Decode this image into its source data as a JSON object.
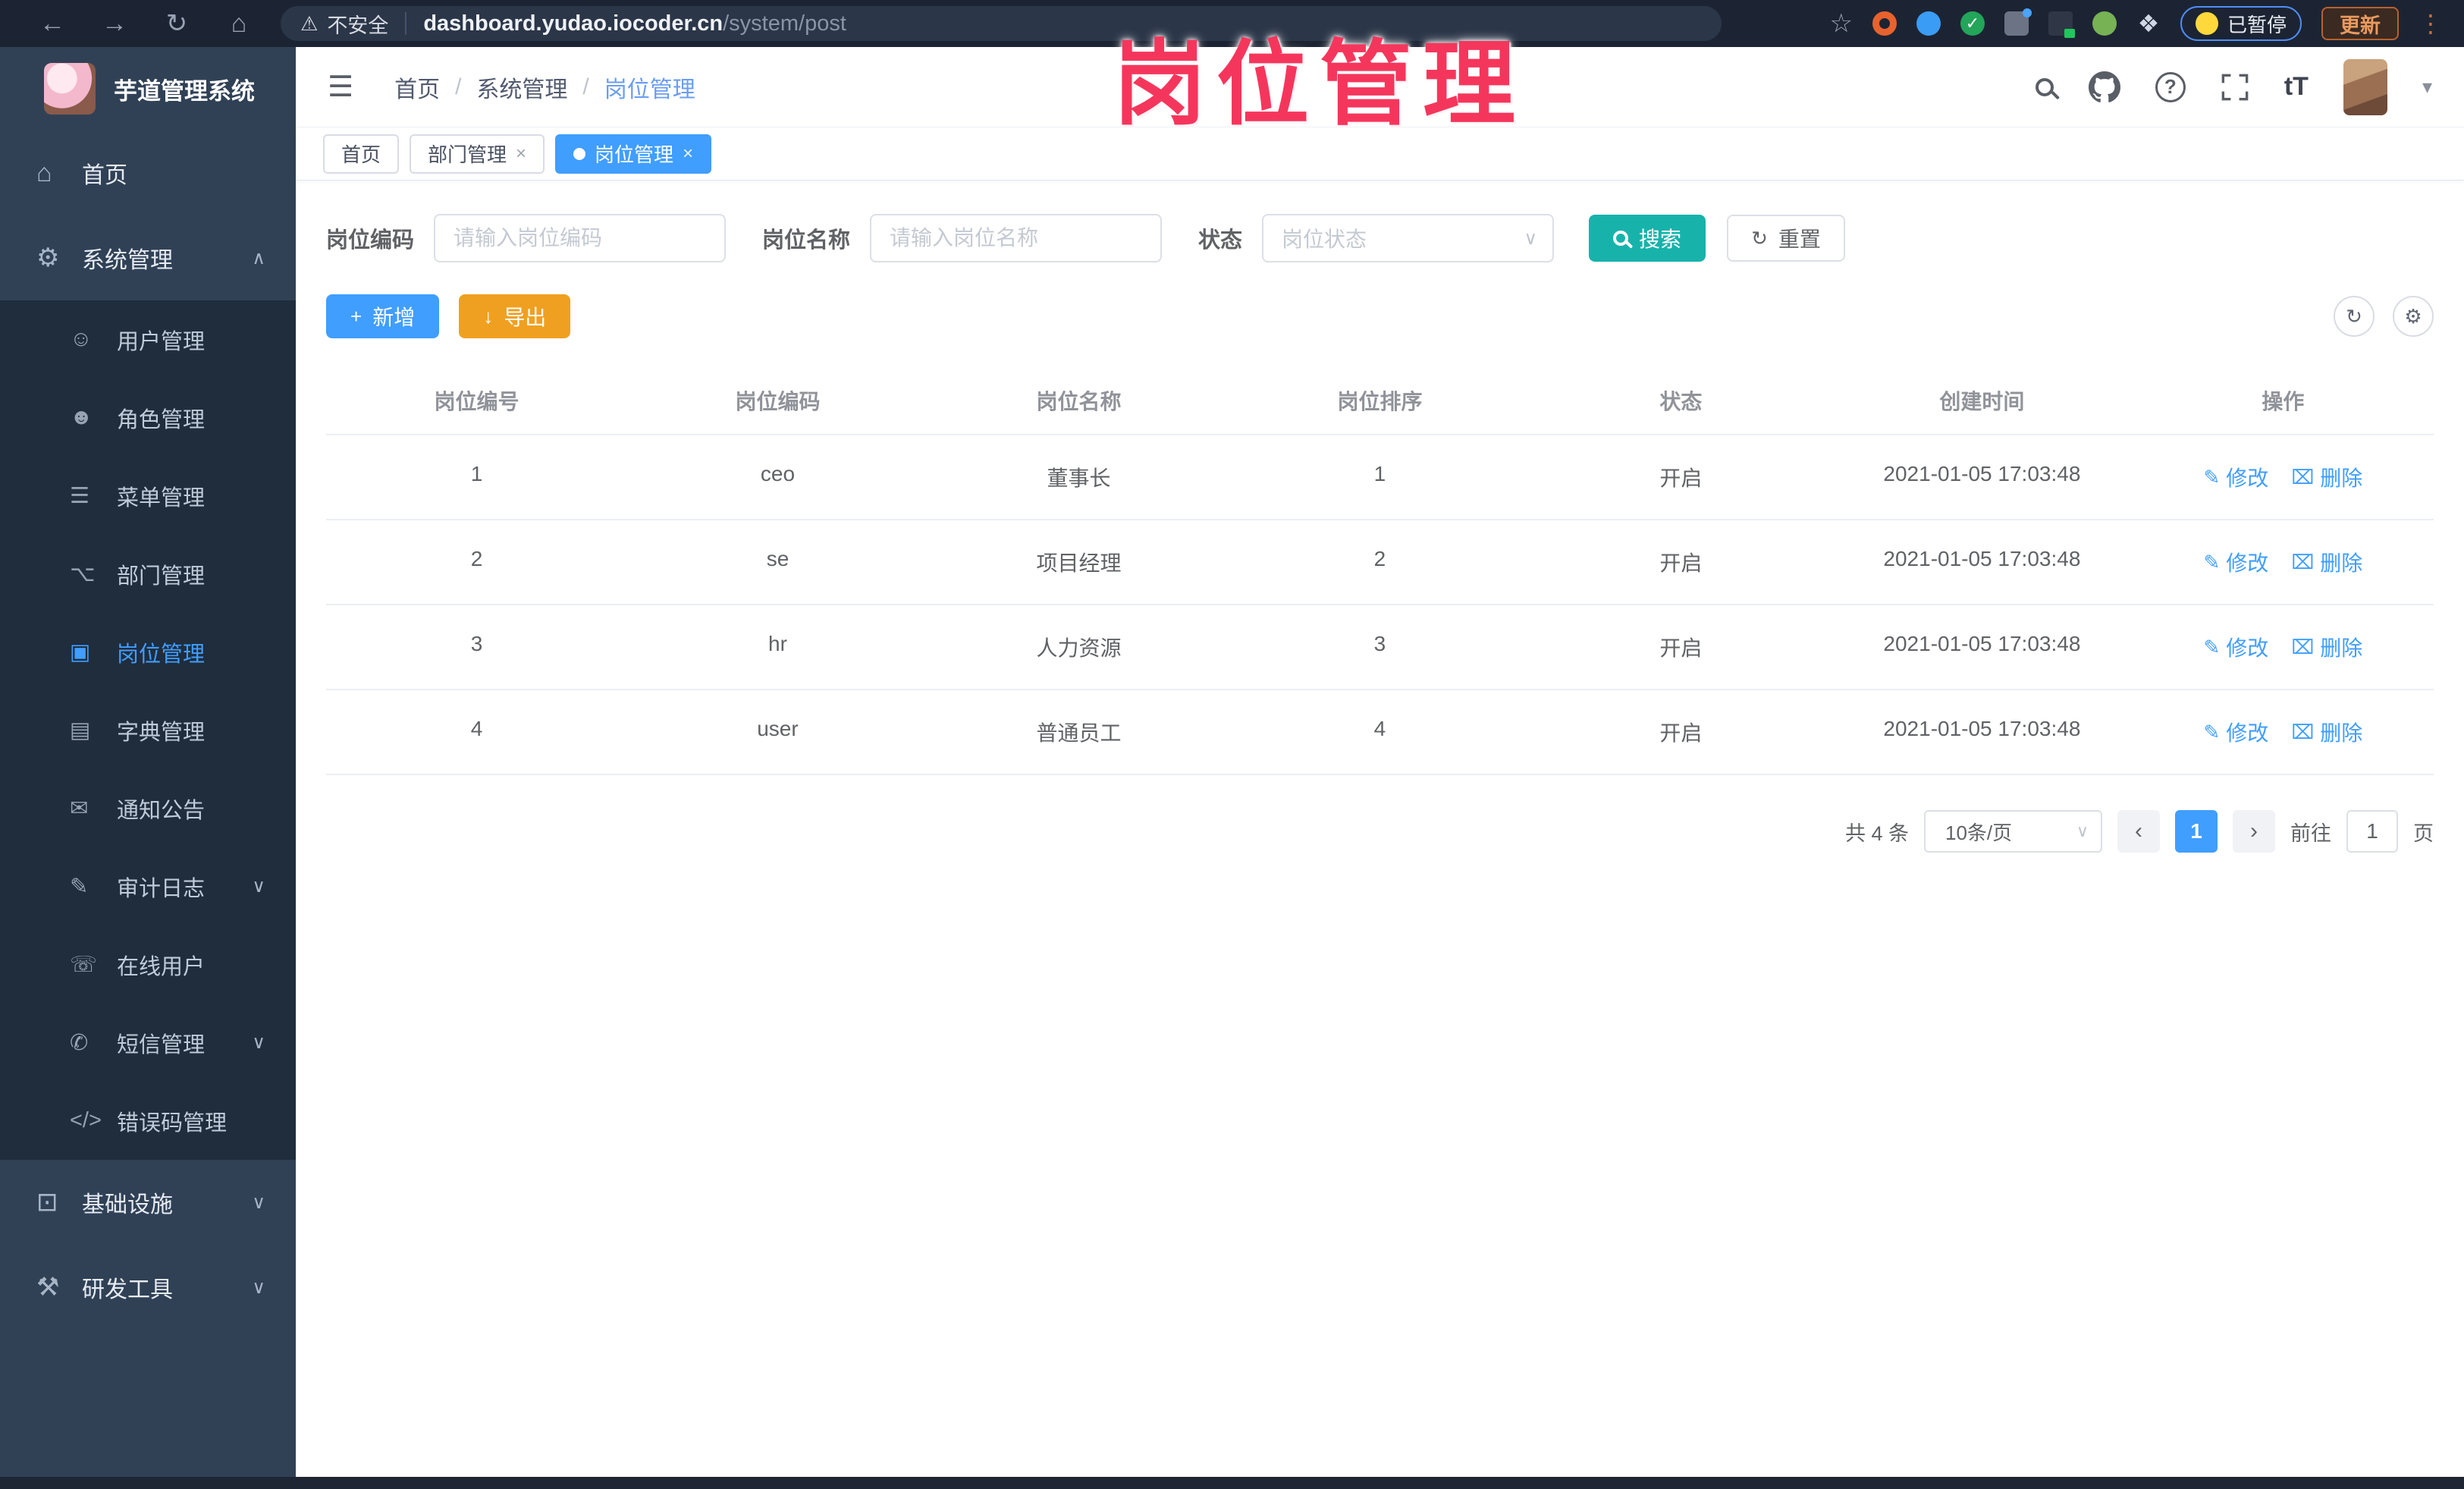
{
  "browser": {
    "security_label": "不安全",
    "url_host": "dashboard.yudao.iocoder.cn",
    "url_path": "/system/post",
    "paused_label": "已暂停",
    "update_label": "更新"
  },
  "watermark": "岗位管理",
  "icons": {
    "back": "←",
    "forward": "→",
    "reload": "↻",
    "home": "⌂",
    "warning": "⚠",
    "star": "☆",
    "check": "✓",
    "puzzle": "❖",
    "dots": "⋮",
    "hamburger": "☰",
    "caret_down": "▾",
    "qmark": "?",
    "chevron_up": "∧",
    "chevron_down": "∨",
    "close": "×",
    "plus": "+",
    "download": "↓",
    "refresh": "↻",
    "gear": "⚙",
    "edit": "✎",
    "delete": "⌧",
    "prev": "‹",
    "next": "›",
    "select_arrow": "∨"
  },
  "sidebar": {
    "app_title": "芋道管理系统",
    "top_items": [
      {
        "label": "首页",
        "icon": "⌂"
      },
      {
        "label": "系统管理",
        "icon": "⚙",
        "chevron": "∧"
      }
    ],
    "submenu": [
      {
        "label": "用户管理",
        "icon": "☺"
      },
      {
        "label": "角色管理",
        "icon": "☻"
      },
      {
        "label": "菜单管理",
        "icon": "☰"
      },
      {
        "label": "部门管理",
        "icon": "⌥"
      },
      {
        "label": "岗位管理",
        "icon": "▣",
        "active": true
      },
      {
        "label": "字典管理",
        "icon": "▤"
      },
      {
        "label": "通知公告",
        "icon": "✉"
      },
      {
        "label": "审计日志",
        "icon": "✎",
        "chevron": "∨"
      },
      {
        "label": "在线用户",
        "icon": "☏"
      },
      {
        "label": "短信管理",
        "icon": "✆",
        "chevron": "∨"
      },
      {
        "label": "错误码管理",
        "icon": "</>"
      }
    ],
    "bottom_items": [
      {
        "label": "基础设施",
        "icon": "⊡",
        "chevron": "∨"
      },
      {
        "label": "研发工具",
        "icon": "⚒",
        "chevron": "∨"
      }
    ]
  },
  "header": {
    "breadcrumb": [
      {
        "label": "首页"
      },
      {
        "label": "系统管理",
        "lead_sep": "/"
      },
      {
        "label": "岗位管理",
        "lead_sep": "/",
        "current": true
      }
    ],
    "font_size_icon_label": "tT"
  },
  "tabs": [
    {
      "label": "首页"
    },
    {
      "label": "部门管理",
      "closable": true
    },
    {
      "label": "岗位管理",
      "closable": true,
      "active": true
    }
  ],
  "filters": {
    "post_code_label": "岗位编码",
    "post_code_placeholder": "请输入岗位编码",
    "post_name_label": "岗位名称",
    "post_name_placeholder": "请输入岗位名称",
    "status_label": "状态",
    "status_placeholder": "岗位状态",
    "search_label": "搜索",
    "reset_label": "重置"
  },
  "toolbar": {
    "add_label": "新增",
    "export_label": "导出"
  },
  "table": {
    "columns": [
      {
        "label": "岗位编号"
      },
      {
        "label": "岗位编码"
      },
      {
        "label": "岗位名称"
      },
      {
        "label": "岗位排序"
      },
      {
        "label": "状态"
      },
      {
        "label": "创建时间"
      },
      {
        "label": "操作"
      }
    ],
    "rows": [
      {
        "id": "1",
        "code": "ceo",
        "name": "董事长",
        "sort": "1",
        "status": "开启",
        "created": "2021-01-05 17:03:48"
      },
      {
        "id": "2",
        "code": "se",
        "name": "项目经理",
        "sort": "2",
        "status": "开启",
        "created": "2021-01-05 17:03:48"
      },
      {
        "id": "3",
        "code": "hr",
        "name": "人力资源",
        "sort": "3",
        "status": "开启",
        "created": "2021-01-05 17:03:48"
      },
      {
        "id": "4",
        "code": "user",
        "name": "普通员工",
        "sort": "4",
        "status": "开启",
        "created": "2021-01-05 17:03:48"
      }
    ],
    "edit_label": "修改",
    "delete_label": "删除"
  },
  "pagination": {
    "total_text": "共 4 条",
    "page_size": "10条/页",
    "current_page": "1",
    "goto_label": "前往",
    "goto_value": "1",
    "page_unit": "页"
  },
  "colors": {
    "primary": "#409eff",
    "search_teal": "#17b3ab",
    "export_orange": "#f0a020",
    "sidebar_bg": "#304156",
    "submenu_bg": "#1f2d3d",
    "watermark_pink": "#f5365c"
  }
}
